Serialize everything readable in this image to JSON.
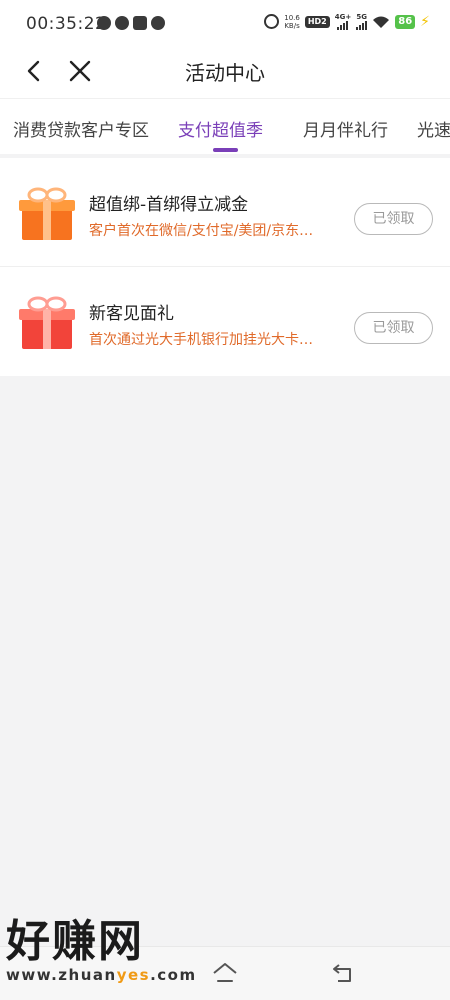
{
  "status_bar": {
    "time": "00:35:22",
    "net_speed_value": "10.6",
    "net_speed_unit": "KB/s",
    "hd_label": "HD2",
    "signal_1": "4G+",
    "signal_2": "5G",
    "battery": "86"
  },
  "nav": {
    "title": "活动中心"
  },
  "tabs": [
    {
      "label": "消费贷款客户专区",
      "active": false
    },
    {
      "label": "支付超值季",
      "active": true
    },
    {
      "label": "月月伴礼行",
      "active": false
    },
    {
      "label": "光速",
      "active": false
    }
  ],
  "activities": [
    {
      "title": "超值绑-首绑得立减金",
      "description": "客户首次在微信/支付宝/美团/京东…",
      "button": "已领取",
      "icon": "gift-box-orange-icon"
    },
    {
      "title": "新客见面礼",
      "description": "首次通过光大手机银行加挂光大卡…",
      "button": "已领取",
      "icon": "gift-box-red-icon"
    }
  ],
  "watermark": {
    "main": "好赚网",
    "sub_prefix": "www.zhuan",
    "sub_highlight": "yes",
    "sub_suffix": ".com"
  },
  "colors": {
    "accent": "#7a3fb8",
    "description": "#e06a2a",
    "background": "#f3f3f4"
  }
}
